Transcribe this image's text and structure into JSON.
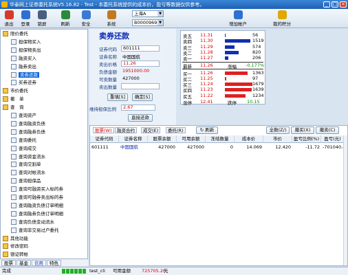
{
  "window": {
    "title": "华泰网上证券委托系统V5.16.82 - Test - 本委托系统提供的成本价，盈亏等数据仅供参考。"
  },
  "toolbar": {
    "buttons": [
      {
        "label": "退出",
        "icon": "exit-icon",
        "color": "#d63b2a"
      },
      {
        "label": "登录",
        "icon": "login-icon",
        "color": "#2f6fd0"
      },
      {
        "label": "锁屏",
        "icon": "lock-icon",
        "color": "#4a5f80"
      },
      {
        "label": "刷新",
        "icon": "refresh-icon",
        "color": "#2a8a3a"
      },
      {
        "label": "安全",
        "icon": "shield-icon",
        "color": "#3a7ad0"
      },
      {
        "label": "系统",
        "icon": "tools-icon",
        "color": "#c07a20"
      },
      {
        "label": "增加帐户",
        "icon": "add-account-icon",
        "color": "#2f6fd0"
      },
      {
        "label": "我的积分",
        "icon": "points-icon",
        "color": "#e0a800"
      }
    ],
    "market": "上海A",
    "account": "B000096912"
  },
  "tree": {
    "items": [
      {
        "label": "限价委托",
        "icon": "folder-icon"
      },
      {
        "label": "担保物买入",
        "icon": "doc-icon"
      },
      {
        "label": "担保物卖出",
        "icon": "doc-icon"
      },
      {
        "label": "融资买入",
        "icon": "doc-icon"
      },
      {
        "label": "融券卖出",
        "icon": "doc-icon"
      },
      {
        "label": "卖券还款",
        "icon": "doc-icon",
        "selected": true
      },
      {
        "label": "买券还券",
        "icon": "doc-icon"
      },
      {
        "label": "市价委托",
        "icon": "folder-icon"
      },
      {
        "label": "撤　单",
        "icon": "folder-icon"
      },
      {
        "label": "查　询",
        "icon": "folder-icon"
      },
      {
        "label": "查询资产",
        "icon": "doc-icon"
      },
      {
        "label": "查询融资负债",
        "icon": "doc-icon"
      },
      {
        "label": "查询融券负债",
        "icon": "doc-icon"
      },
      {
        "label": "查询委托",
        "icon": "doc-icon"
      },
      {
        "label": "查询成交",
        "icon": "doc-icon"
      },
      {
        "label": "查询资金流水",
        "icon": "doc-icon"
      },
      {
        "label": "查询交割单",
        "icon": "doc-icon"
      },
      {
        "label": "查询对帐流水",
        "icon": "doc-icon"
      },
      {
        "label": "查询担保品",
        "icon": "doc-icon"
      },
      {
        "label": "查询可融资买入标的券",
        "icon": "doc-icon"
      },
      {
        "label": "查询可融券卖出标的券",
        "icon": "doc-icon"
      },
      {
        "label": "查询融资负债订单明细",
        "icon": "doc-icon"
      },
      {
        "label": "查询融券负债订单明细",
        "icon": "doc-icon"
      },
      {
        "label": "查询负债变动流水",
        "icon": "doc-icon"
      },
      {
        "label": "查询非交易过户委托",
        "icon": "doc-icon"
      },
      {
        "label": "其他功能",
        "icon": "folder-icon"
      },
      {
        "label": "修改密码",
        "icon": "folder-icon"
      },
      {
        "label": "银证转帐",
        "icon": "folder-icon"
      }
    ],
    "tabs": [
      "股票",
      "基金",
      "信用",
      "特色"
    ]
  },
  "form": {
    "title": "卖券还款",
    "code_label": "证券代码",
    "code": "601111",
    "name_label": "证券名称",
    "name": "中国国航",
    "price_label": "卖出价格",
    "price": "11.26",
    "debt_label": "负债金额",
    "debt": "1951000.00",
    "avail_label": "可卖数量",
    "avail": "427000",
    "qty_label": "卖出数量",
    "qty": "",
    "reset": "重填[S]",
    "confirm": "确定[S]",
    "ratio_label": "维持担保比例",
    "ratio": "2.67",
    "repay": "直接还款"
  },
  "quote": {
    "sells": [
      {
        "label": "卖五",
        "price": "11.31",
        "vol": "56",
        "bar": 0.03
      },
      {
        "label": "卖四",
        "price": "11.30",
        "vol": "1519",
        "bar": 0.93
      },
      {
        "label": "卖三",
        "price": "11.29",
        "vol": "574",
        "bar": 0.35
      },
      {
        "label": "卖二",
        "price": "11.28",
        "vol": "820",
        "bar": 0.5
      },
      {
        "label": "卖一",
        "price": "11.27",
        "vol": "206",
        "bar": 0.13
      }
    ],
    "last_label": "最新",
    "last": "11.26",
    "chg_label": "涨幅",
    "chg": "-0.177%",
    "buys": [
      {
        "label": "买一",
        "price": "11.26",
        "vol": "1363",
        "bar": 0.83
      },
      {
        "label": "买二",
        "price": "11.25",
        "vol": "97",
        "bar": 0.06
      },
      {
        "label": "买三",
        "price": "11.24",
        "vol": "1679",
        "bar": 1.0
      },
      {
        "label": "买四",
        "price": "11.23",
        "vol": "1639",
        "bar": 0.98
      },
      {
        "label": "买五",
        "price": "11.22",
        "vol": "1234",
        "bar": 0.75
      }
    ],
    "up_label": "涨停",
    "up": "12.41",
    "down_label": "跌停",
    "down": "10.15"
  },
  "grid": {
    "tabs": [
      "股票(W)",
      "融资合约",
      "成交(E)",
      "委托(R)"
    ],
    "refresh": "刷新",
    "actions": [
      "全数(Z/)",
      "撤买(X)",
      "撤卖(C)"
    ],
    "headers": [
      "证券代码",
      "证券名称",
      "股票余额",
      "可用余额",
      "冻结数量",
      "成本价",
      "市价",
      "盈亏比例(%)",
      "盈亏(元)"
    ],
    "rows": [
      [
        "601111",
        "中国国航",
        "427000",
        "427000",
        "0",
        "14.069",
        "12.420",
        "-11.72",
        "-701040.40"
      ]
    ]
  },
  "status": {
    "left": "完成",
    "user": "test_cli",
    "avail_label": "可用金额",
    "avail": "725705.20",
    "unit": "元"
  }
}
